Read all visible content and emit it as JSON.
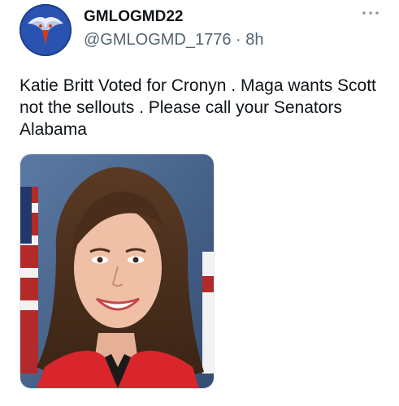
{
  "tweet": {
    "display_name": "GMLOGMD22",
    "handle": "@GMLOGMD_1776",
    "separator": "·",
    "time": "8h",
    "text": "Katie Britt Voted for Cronyn . Maga wants Scott not the sellouts . Please call your Senators Alabama",
    "avatar_icon": "eagle-icon",
    "more_icon": "more-dots-icon",
    "media_description_icon": "portrait-photo"
  },
  "colors": {
    "text_primary": "#0f1419",
    "text_secondary": "#536471",
    "avatar_bg": "#1f3f8f",
    "photo_background": "#4a6a92"
  }
}
